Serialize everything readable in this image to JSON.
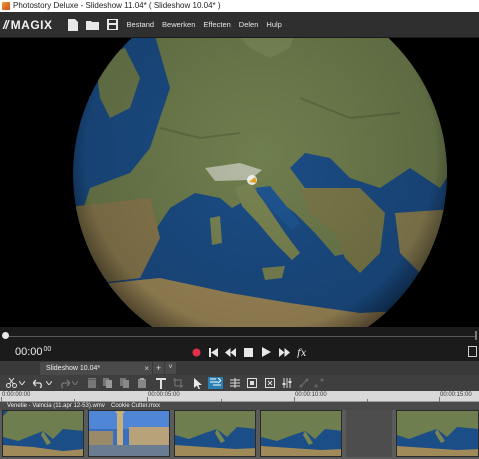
{
  "window": {
    "title": "Photostory Deluxe - Slideshow  11.04* ( Slideshow  10.04* )"
  },
  "menubar": {
    "logo_mark": "//",
    "logo_text": "MAGIX",
    "items": [
      "Bestand",
      "Bewerken",
      "Effecten",
      "Delen",
      "Hulp"
    ]
  },
  "player": {
    "timecode": "00:00",
    "timecode_frames": "00",
    "position_fraction": 0.0
  },
  "tabs": {
    "active_label": "Slideshow  10.04*",
    "close_glyph": "×",
    "add_glyph": "+",
    "menu_glyph": "˅"
  },
  "ruler": {
    "labels": [
      "0:00:00:00",
      "00:00:05:00",
      "00:00:10:00",
      "00:00:15:00"
    ]
  },
  "track": {
    "clip_labels": [
      "Venetie - Valncia (11.apr 12-53).wmv",
      "Cookie Cutter.mxx"
    ]
  },
  "colors": {
    "accent": "#2a7fb5",
    "record": "#e0304a",
    "ocean": "#1b4d86",
    "land": "#6f7e4e"
  },
  "icons": {
    "new": "new-document-icon",
    "open": "folder-icon",
    "save": "save-icon",
    "record": "record-icon",
    "fx": "fx-icon"
  }
}
